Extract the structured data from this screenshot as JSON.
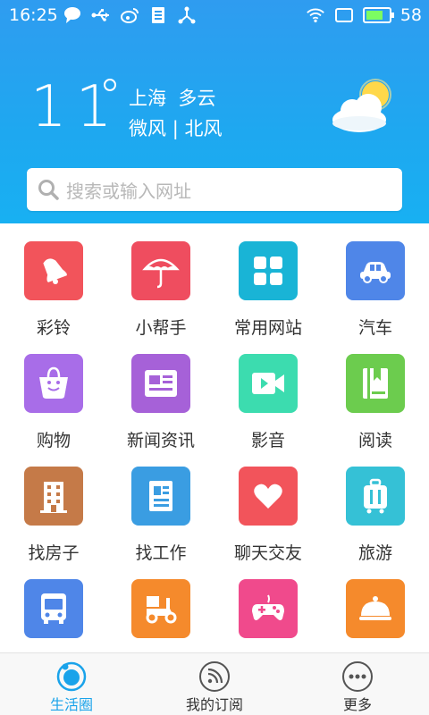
{
  "status_bar": {
    "time": "16:25",
    "battery_level": "58",
    "icons": [
      "message-icon",
      "usb-icon",
      "weibo-icon",
      "sim-icon",
      "share-icon",
      "wifi-icon",
      "screen-icon",
      "battery-icon"
    ]
  },
  "weather": {
    "temperature": "11",
    "city": "上海",
    "condition": "多云",
    "wind_strength": "微风",
    "wind_direction": "北风",
    "separator": "|",
    "icon": "partly-cloudy-icon"
  },
  "search": {
    "placeholder": "搜索或输入网址"
  },
  "grid": {
    "items": [
      {
        "label": "彩铃",
        "icon": "bell-icon",
        "color": "#f2545b"
      },
      {
        "label": "小帮手",
        "icon": "umbrella-icon",
        "color": "#ef4d5f"
      },
      {
        "label": "常用网站",
        "icon": "grid-icon",
        "color": "#19b4d6"
      },
      {
        "label": "汽车",
        "icon": "car-icon",
        "color": "#4f86e8"
      },
      {
        "label": "购物",
        "icon": "shopping-bag-icon",
        "color": "#a86de8"
      },
      {
        "label": "新闻资讯",
        "icon": "news-icon",
        "color": "#a661d8"
      },
      {
        "label": "影音",
        "icon": "video-icon",
        "color": "#3cdcaf"
      },
      {
        "label": "阅读",
        "icon": "book-icon",
        "color": "#6ccc4e"
      },
      {
        "label": "找房子",
        "icon": "building-icon",
        "color": "#c57a48"
      },
      {
        "label": "找工作",
        "icon": "newspaper-icon",
        "color": "#3a9de2"
      },
      {
        "label": "聊天交友",
        "icon": "heart-icon",
        "color": "#f2545b"
      },
      {
        "label": "旅游",
        "icon": "luggage-icon",
        "color": "#35c1d6"
      },
      {
        "label": "",
        "icon": "bus-icon",
        "color": "#4f86e8"
      },
      {
        "label": "",
        "icon": "scooter-icon",
        "color": "#f58a2c"
      },
      {
        "label": "",
        "icon": "gamepad-icon",
        "color": "#f04a8c"
      },
      {
        "label": "",
        "icon": "food-cloche-icon",
        "color": "#f58a2c"
      }
    ]
  },
  "bottom_nav": {
    "items": [
      {
        "label": "生活圈",
        "icon": "life-circle-icon",
        "active": true
      },
      {
        "label": "我的订阅",
        "icon": "rss-icon",
        "active": false
      },
      {
        "label": "更多",
        "icon": "more-icon",
        "active": false
      }
    ]
  },
  "colors": {
    "accent": "#1aa3ea",
    "header_top": "#2f9cf0",
    "header_bottom": "#18b0f2"
  }
}
